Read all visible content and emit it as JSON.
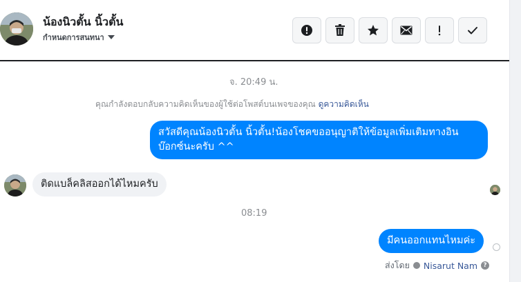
{
  "header": {
    "contact_name": "น้องนิวตั้น นิ้วตั้น",
    "conversation_settings_label": "กำหนดการสนทนา",
    "actions": [
      {
        "name": "report-button",
        "icon": "exclamation-circle-icon"
      },
      {
        "name": "delete-button",
        "icon": "trash-icon"
      },
      {
        "name": "star-button",
        "icon": "star-icon"
      },
      {
        "name": "mark-unread-button",
        "icon": "envelope-icon"
      },
      {
        "name": "important-button",
        "icon": "exclamation-icon"
      },
      {
        "name": "mark-done-button",
        "icon": "check-icon"
      }
    ]
  },
  "thread": {
    "timestamp_1": "จ. 20:49 น.",
    "reply_notice_text": "คุณกำลังตอบกลับความคิดเห็นของผู้ใช้ต่อโพสต์บนเพจของคุณ",
    "reply_notice_link": "ดูความคิดเห็น",
    "outgoing_message_1": "สวัสดีคุณน้องนิวตั้น นิ้วตั้น!น้องโชคขออนุญาติให้ข้อมูลเพิ่มเติมทางอินบ๊อกซ์นะครับ ^^",
    "incoming_message_1": "ติดแบล็คลิสออกได้ไหมครับ",
    "timestamp_2": "08:19",
    "outgoing_message_2": "มีคนออกแทนไหมค่ะ",
    "sent_by_label": "ส่งโดย",
    "sent_by_name": "Nisarut Nam"
  },
  "colors": {
    "outgoing_bubble": "#0084ff",
    "incoming_bubble": "#f0f2f5",
    "link": "#385898"
  }
}
